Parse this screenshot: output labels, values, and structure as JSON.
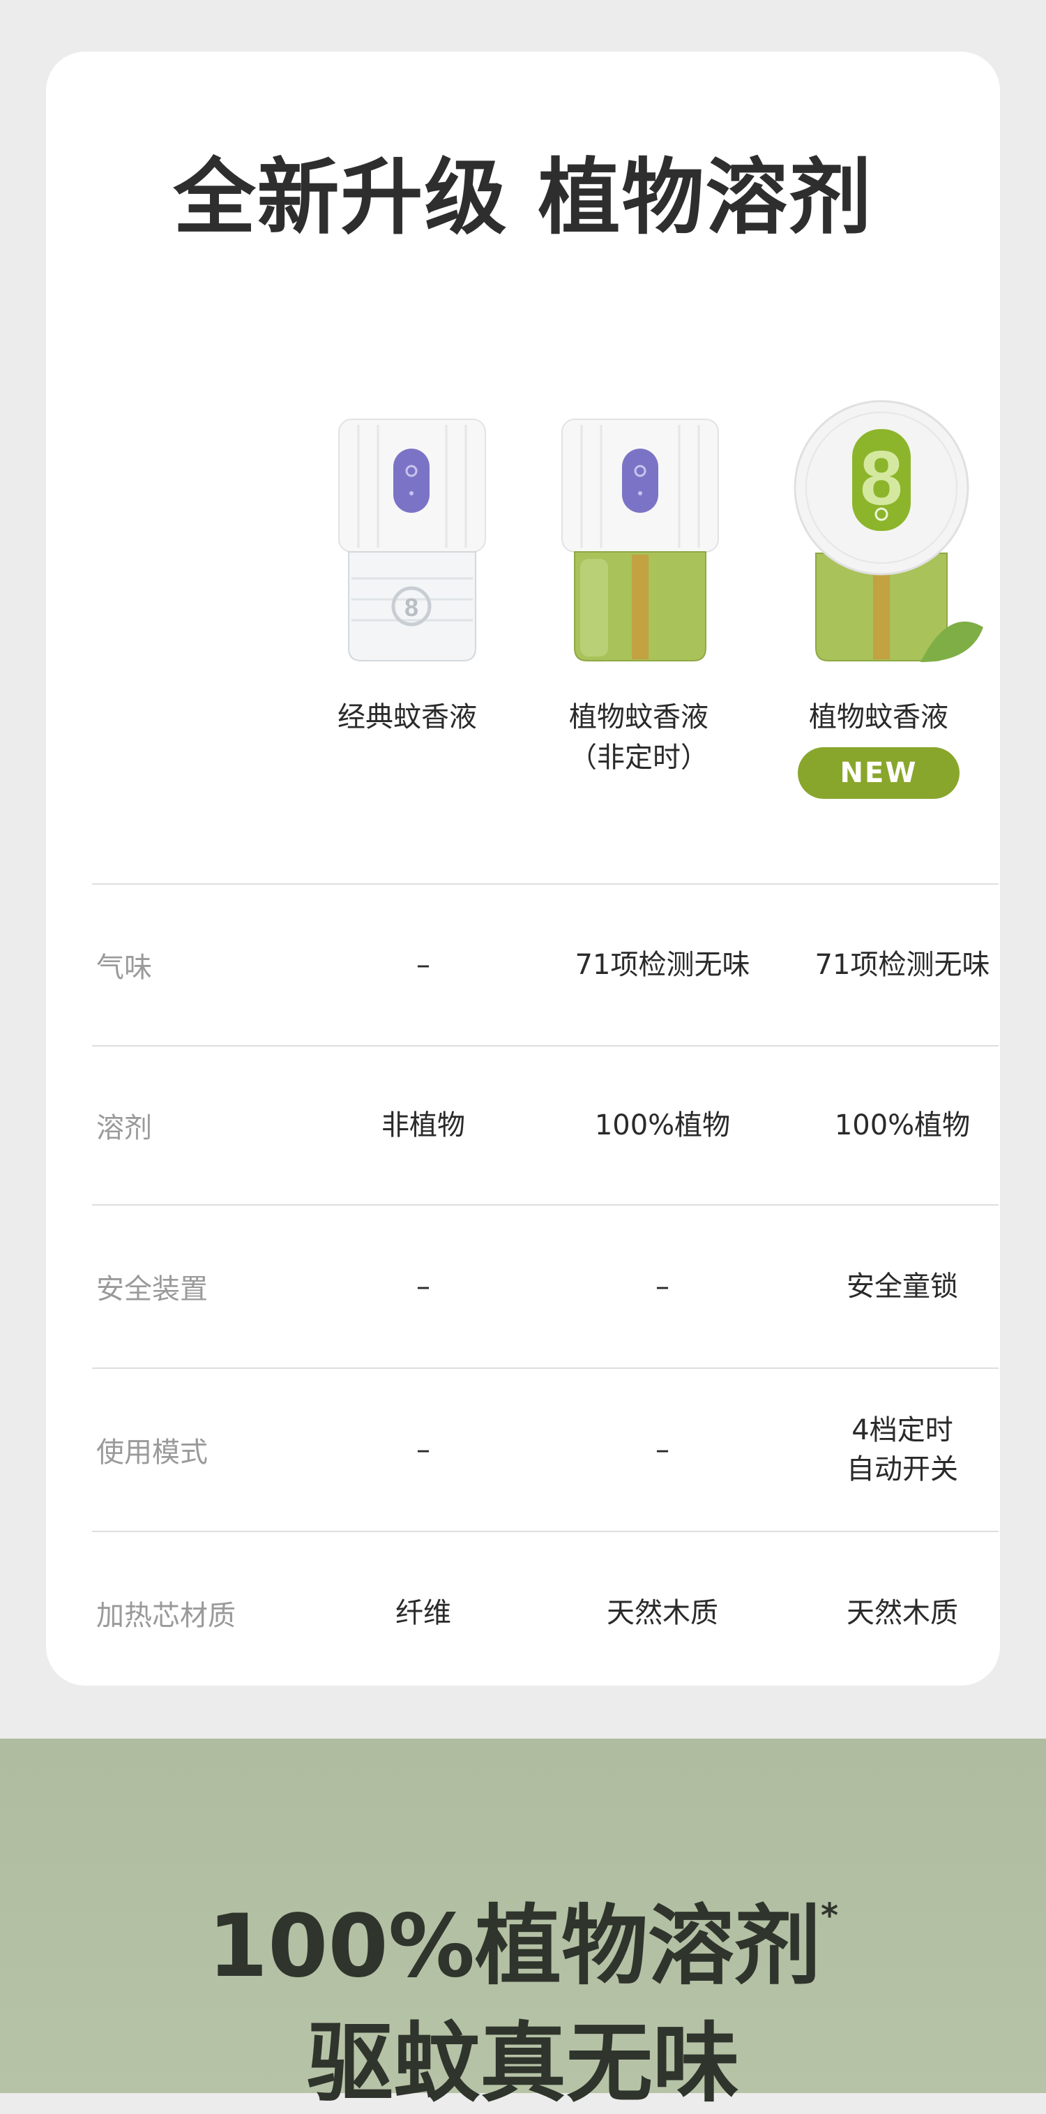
{
  "header": {
    "title": "全新升级 植物溶剂"
  },
  "products": [
    {
      "name": "经典蚊香液",
      "name_sub": "",
      "badge": ""
    },
    {
      "name": "植物蚊香液",
      "name_sub": "（非定时）",
      "badge": ""
    },
    {
      "name": "植物蚊香液",
      "name_sub": "",
      "badge": "NEW"
    }
  ],
  "comparison": [
    {
      "label": "气味",
      "values": [
        "–",
        "71项检测无味",
        "71项检测无味"
      ]
    },
    {
      "label": "溶剂",
      "values": [
        "非植物",
        "100%植物",
        "100%植物"
      ]
    },
    {
      "label": "安全装置",
      "values": [
        "–",
        "–",
        "安全童锁"
      ]
    },
    {
      "label": "使用模式",
      "values": [
        "–",
        "–",
        "4档定时\n自动开关"
      ]
    },
    {
      "label": "加热芯材质",
      "values": [
        "纤维",
        "天然木质",
        "天然木质"
      ]
    }
  ],
  "promo": {
    "line1": "100%植物溶剂",
    "asterisk": "*",
    "line2": "驱蚊真无味"
  },
  "colors": {
    "accent_green": "#89a62c",
    "liquid_green": "#a9c25a",
    "button_purple": "#7b74c6",
    "promo_bg": "#b3c0a3"
  }
}
